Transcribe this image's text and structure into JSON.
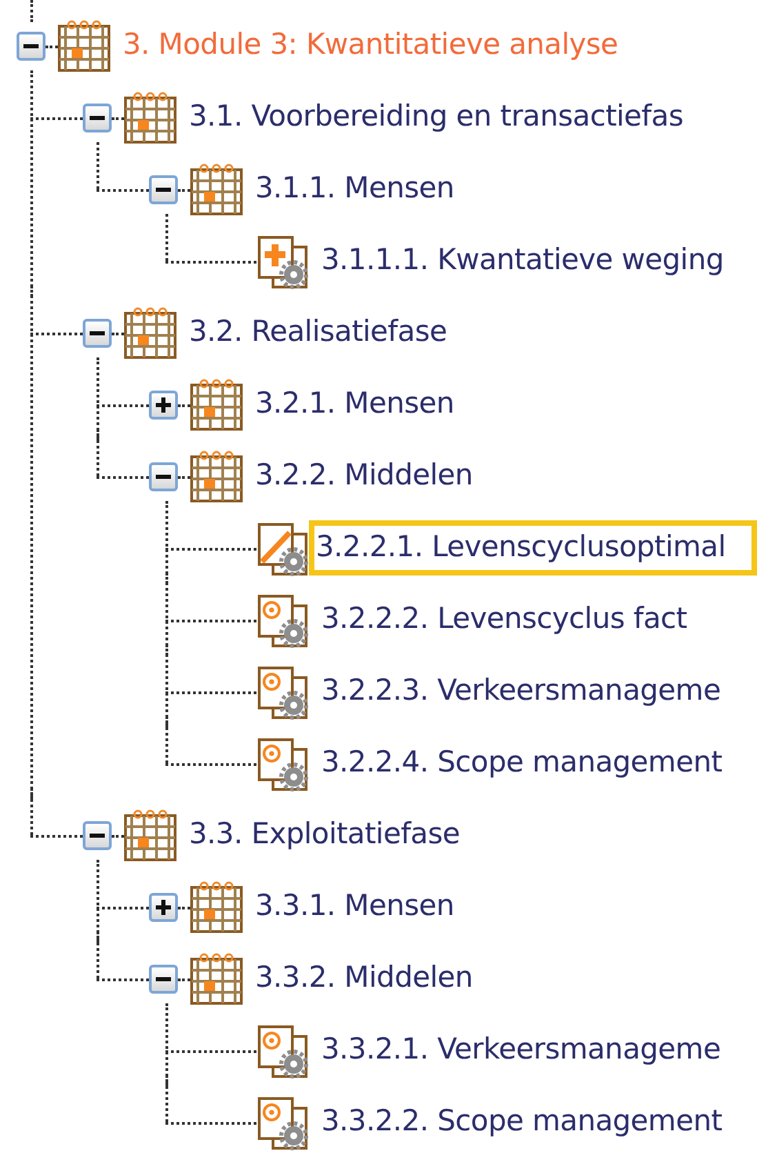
{
  "tree": [
    {
      "label": "3. Module 3: Kwantitatieve analyse",
      "kind": "phase",
      "expanded": true,
      "selected": false,
      "color": "#f26b3a",
      "children": [
        {
          "label": "3.1. Voorbereiding en transactiefas",
          "kind": "phase",
          "expanded": true,
          "selected": false,
          "color": "#2b2d6b",
          "children": [
            {
              "label": "3.1.1. Mensen",
              "kind": "phase",
              "expanded": true,
              "selected": false,
              "color": "#2b2d6b",
              "children": [
                {
                  "label": "3.1.1.1. Kwantatieve weging",
                  "kind": "task-added",
                  "selected": false,
                  "color": "#2b2d6b"
                }
              ]
            }
          ]
        },
        {
          "label": "3.2. Realisatiefase",
          "kind": "phase",
          "expanded": true,
          "selected": false,
          "color": "#2b2d6b",
          "children": [
            {
              "label": "3.2.1. Mensen",
              "kind": "phase",
              "expanded": false,
              "selected": false,
              "color": "#2b2d6b"
            },
            {
              "label": "3.2.2. Middelen",
              "kind": "phase",
              "expanded": true,
              "selected": false,
              "color": "#2b2d6b",
              "children": [
                {
                  "label": "3.2.2.1. Levenscyclusoptimal",
                  "kind": "task-editing",
                  "selected": true,
                  "color": "#2b2d6b"
                },
                {
                  "label": "3.2.2.2. Levenscyclus fact",
                  "kind": "task",
                  "selected": false,
                  "color": "#2b2d6b"
                },
                {
                  "label": "3.2.2.3. Verkeersmanageme",
                  "kind": "task",
                  "selected": false,
                  "color": "#2b2d6b"
                },
                {
                  "label": "3.2.2.4. Scope management",
                  "kind": "task",
                  "selected": false,
                  "color": "#2b2d6b"
                }
              ]
            }
          ]
        },
        {
          "label": "3.3. Exploitatiefase",
          "kind": "phase",
          "expanded": true,
          "selected": false,
          "color": "#2b2d6b",
          "children": [
            {
              "label": "3.3.1. Mensen",
              "kind": "phase",
              "expanded": false,
              "selected": false,
              "color": "#2b2d6b"
            },
            {
              "label": "3.3.2. Middelen",
              "kind": "phase",
              "expanded": true,
              "selected": false,
              "color": "#2b2d6b",
              "children": [
                {
                  "label": "3.3.2.1. Verkeersmanageme",
                  "kind": "task",
                  "selected": false,
                  "color": "#2b2d6b"
                },
                {
                  "label": "3.3.2.2. Scope management",
                  "kind": "task",
                  "selected": false,
                  "color": "#2b2d6b"
                }
              ]
            }
          ]
        }
      ]
    }
  ]
}
